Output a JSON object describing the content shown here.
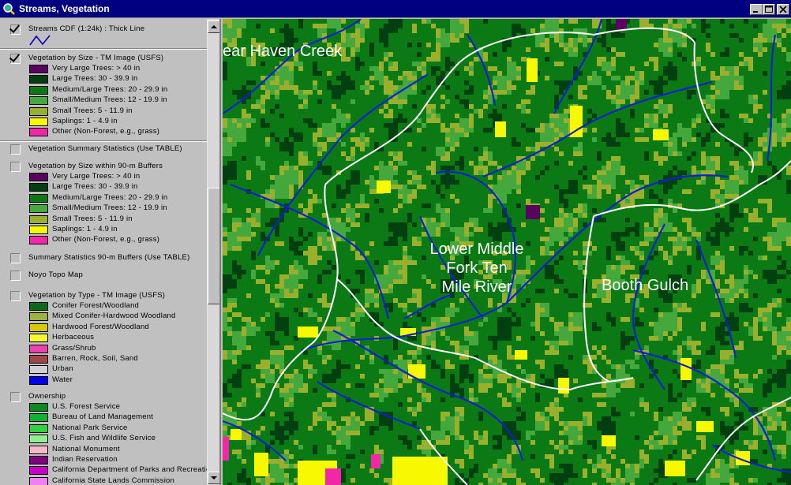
{
  "window": {
    "title": "Streams, Vegetation",
    "icon": "magnifier-globe-icon",
    "controls": [
      "minimize",
      "maximize",
      "close"
    ]
  },
  "legend": {
    "layers": [
      {
        "title": "Streams CDF (1:24k) : Thick Line",
        "checked": true,
        "line_symbol": {
          "color": "#0000c8"
        },
        "items": []
      },
      {
        "title": "Vegetation by Size - TM Image (USFS)",
        "checked": true,
        "items": [
          {
            "label": "Very Large Trees: > 40  in",
            "color": "#5a0060"
          },
          {
            "label": "Large Trees: 30 - 39.9 in",
            "color": "#004010"
          },
          {
            "label": "Medium/Large Trees: 20 - 29.9 in",
            "color": "#0b7a14"
          },
          {
            "label": "Small/Medium Trees: 12 - 19.9 in",
            "color": "#45a83c"
          },
          {
            "label": "Small Trees: 5 - 11.9 in",
            "color": "#9ab02c"
          },
          {
            "label": "Saplings: 1 - 4.9 in",
            "color": "#f8f800"
          },
          {
            "label": "Other (Non-Forest, e.g., grass)",
            "color": "#f028a8"
          }
        ]
      },
      {
        "title": "Vegetation Summary Statistics (Use TABLE)",
        "checked": false,
        "items": []
      },
      {
        "title": "Vegetation by Size within 90-m Buffers",
        "checked": false,
        "items": [
          {
            "label": "Very Large Trees: > 40  in",
            "color": "#5a0060"
          },
          {
            "label": "Large Trees: 30 - 39.9 in",
            "color": "#004010"
          },
          {
            "label": "Medium/Large Trees: 20 - 29.9 in",
            "color": "#0b7a14"
          },
          {
            "label": "Small/Medium Trees: 12 - 19.9 in",
            "color": "#45a83c"
          },
          {
            "label": "Small Trees: 5 - 11.9 in",
            "color": "#9ab02c"
          },
          {
            "label": "Saplings: 1 - 4.9 in",
            "color": "#f8f800"
          },
          {
            "label": "Other (Non-Forest, e.g., grass)",
            "color": "#f028a8"
          }
        ]
      },
      {
        "title": "Summary Statistics 90-m Buffers (Use TABLE)",
        "checked": false,
        "items": []
      },
      {
        "title": "Noyo Topo Map",
        "checked": false,
        "items": []
      },
      {
        "title": "Vegetation by Type - TM Image (USFS)",
        "checked": false,
        "items": [
          {
            "label": "Conifer Forest/Woodland",
            "color": "#0b6a18"
          },
          {
            "label": "Mixed Conifer-Hardwood Woodland",
            "color": "#a0b040"
          },
          {
            "label": "Hardwood Forest/Woodland",
            "color": "#d8c800"
          },
          {
            "label": "Herbaceous",
            "color": "#f8f830"
          },
          {
            "label": "Grass/Shrub",
            "color": "#f040b0"
          },
          {
            "label": "Barren, Rock, Soil, Sand",
            "color": "#a04848"
          },
          {
            "label": "Urban",
            "color": "#d0d0d0"
          },
          {
            "label": "Water",
            "color": "#0000e8"
          }
        ]
      },
      {
        "title": "Ownership",
        "checked": false,
        "items": [
          {
            "label": "U.S. Forest Service",
            "color": "#0a8a20"
          },
          {
            "label": "Bureau of Land Management",
            "color": "#10b030"
          },
          {
            "label": "National Park Service",
            "color": "#30d040"
          },
          {
            "label": "U.S. Fish and Wildlife Service",
            "color": "#90f090"
          },
          {
            "label": "National Monument",
            "color": "#f8b8c8"
          },
          {
            "label": "Indian Reservation",
            "color": "#800080"
          },
          {
            "label": "California Department of Parks and Recreation",
            "color": "#c800c8"
          },
          {
            "label": "California State Lands Commission",
            "color": "#f080f0"
          }
        ]
      }
    ]
  },
  "map": {
    "labels": [
      {
        "text": "ear Haven Creek"
      },
      {
        "text": "Lower Middle\nFork Ten\nMile River"
      },
      {
        "text": "Booth Gulch"
      }
    ],
    "colors": {
      "streams": "#1020d0",
      "boundaries": "#ffffff",
      "dominant": "#0b7a14"
    }
  }
}
